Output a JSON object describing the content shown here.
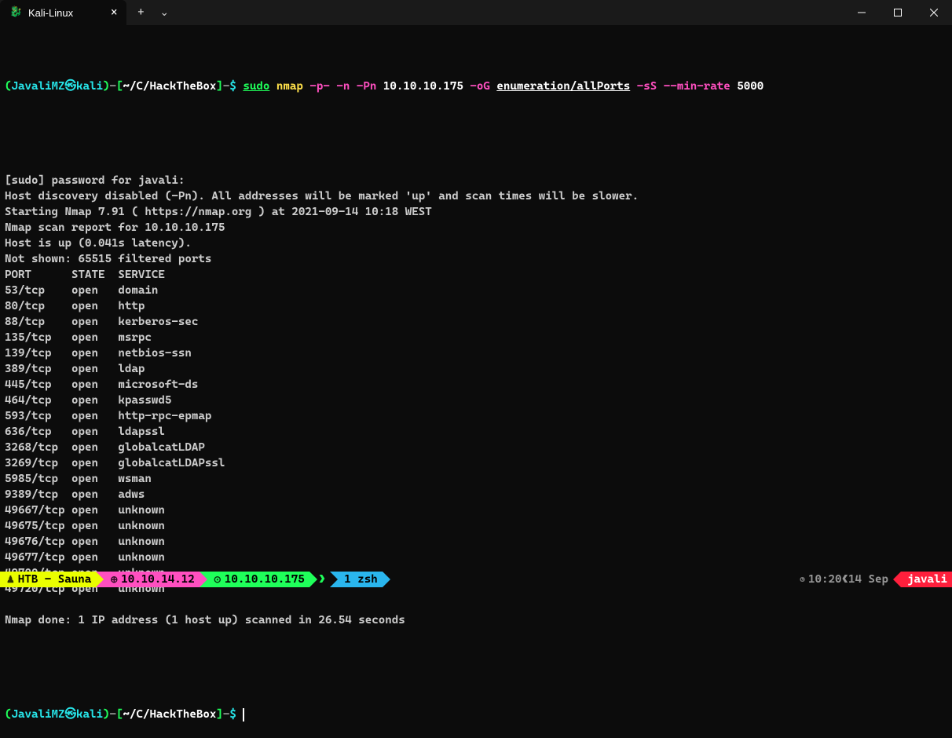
{
  "window": {
    "tab_title": "Kali-Linux"
  },
  "prompt1": {
    "open_paren": "(",
    "user": "JavaliMZ",
    "sep_icon": "㉿",
    "host": "kali",
    "close_paren": ")",
    "dash": "-",
    "bracket_open": "[",
    "path": "~/C/HackTheBox",
    "bracket_close": "]",
    "dash2": "-",
    "dollar": "$ ",
    "cmd_sudo": "sudo",
    "cmd_space1": " ",
    "cmd_nmap": "nmap",
    "cmd_space2": " ",
    "flag_p": "-p-",
    "sp1": " ",
    "flag_n": "-n",
    "sp2": " ",
    "flag_Pn": "-Pn",
    "sp3": " ",
    "target": "10.10.10.175",
    "sp4": " ",
    "flag_oG": "-oG",
    "sp5": " ",
    "outfile": "enumeration/allPorts",
    "sp6": " ",
    "flag_sS": "-sS",
    "sp7": " ",
    "flag_minrate": "--min-rate",
    "sp8": " ",
    "rate": "5000"
  },
  "output": {
    "lines": [
      "",
      "[sudo] password for javali:",
      "Host discovery disabled (-Pn). All addresses will be marked 'up' and scan times will be slower.",
      "Starting Nmap 7.91 ( https://nmap.org ) at 2021-09-14 10:18 WEST",
      "Nmap scan report for 10.10.10.175",
      "Host is up (0.041s latency).",
      "Not shown: 65515 filtered ports",
      "PORT      STATE  SERVICE",
      "53/tcp    open   domain",
      "80/tcp    open   http",
      "88/tcp    open   kerberos-sec",
      "135/tcp   open   msrpc",
      "139/tcp   open   netbios-ssn",
      "389/tcp   open   ldap",
      "445/tcp   open   microsoft-ds",
      "464/tcp   open   kpasswd5",
      "593/tcp   open   http-rpc-epmap",
      "636/tcp   open   ldapssl",
      "3268/tcp  open   globalcatLDAP",
      "3269/tcp  open   globalcatLDAPssl",
      "5985/tcp  open   wsman",
      "9389/tcp  open   adws",
      "49667/tcp open   unknown",
      "49675/tcp open   unknown",
      "49676/tcp open   unknown",
      "49677/tcp open   unknown",
      "49700/tcp open   unknown",
      "49720/tcp open   unknown",
      "",
      "Nmap done: 1 IP address (1 host up) scanned in 26.54 seconds",
      ""
    ]
  },
  "prompt2": {
    "open_paren": "(",
    "user": "JavaliMZ",
    "sep_icon": "㉿",
    "host": "kali",
    "close_paren": ")",
    "dash": "-",
    "bracket_open": "[",
    "path": "~/C/HackTheBox",
    "bracket_close": "]",
    "dash2": "-",
    "dollar": "$ "
  },
  "statusbar": {
    "seg1_icon": "♟",
    "seg1_text": " HTB - Sauna ",
    "seg2_icon": "⊕",
    "seg2_text": " 10.10.14.12 ",
    "seg3_icon": "⊙",
    "seg3_text": " 10.10.10.175 ",
    "seg4_text": " 1 zsh ",
    "right_time_icon": "◷",
    "right_time": " 10:20 ",
    "right_sep": "❮",
    "right_date": " 14 Sep ",
    "seg_user": " javali "
  }
}
